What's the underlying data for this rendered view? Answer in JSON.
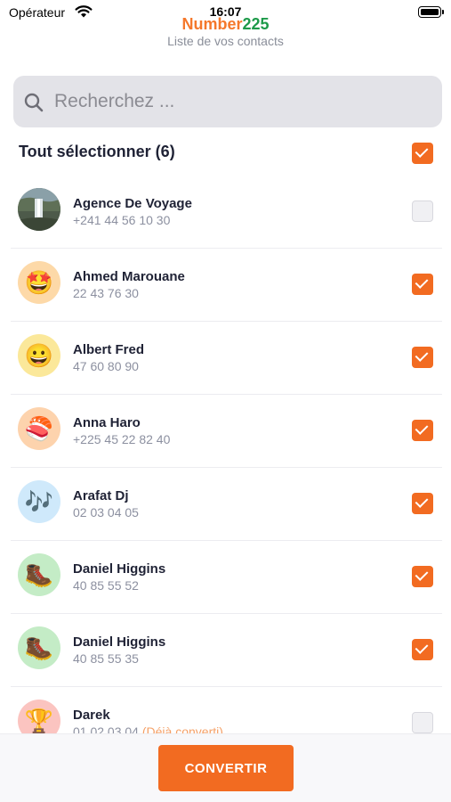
{
  "status_bar": {
    "carrier": "Opérateur",
    "time": "16:07"
  },
  "header": {
    "brand_part1": "Number",
    "brand_part2": "225",
    "subtitle": "Liste de vos contacts"
  },
  "search": {
    "placeholder": "Recherchez ..."
  },
  "select_all": {
    "label": "Tout sélectionner (6)",
    "checked": true
  },
  "contacts": [
    {
      "name": "Agence De Voyage",
      "phone": "+241 44 56 10 30",
      "avatar": "photo-waterfall",
      "checked": false
    },
    {
      "name": "Ahmed Marouane",
      "phone": "22 43 76 30",
      "avatar": "🤩",
      "checked": true
    },
    {
      "name": "Albert Fred",
      "phone": "47 60 80 90",
      "avatar": "😀",
      "checked": true
    },
    {
      "name": "Anna Haro",
      "phone": "+225 45 22 82 40",
      "avatar": "🍣",
      "checked": true
    },
    {
      "name": "Arafat Dj",
      "phone": "02 03 04 05",
      "avatar": "🎶",
      "checked": true
    },
    {
      "name": "Daniel Higgins",
      "phone": "40 85 55 52",
      "avatar": "🥾",
      "checked": true
    },
    {
      "name": "Daniel Higgins",
      "phone": "40 85 55 35",
      "avatar": "🥾",
      "checked": true
    },
    {
      "name": "Darek",
      "phone": "01 02 03 04",
      "note": "(Déjà converti)",
      "avatar": "🏆",
      "checked": false
    }
  ],
  "colors": {
    "accent": "#f26b21",
    "brand_green": "#1d9a49",
    "brand_orange": "#f5782b"
  },
  "bottom": {
    "convert_label": "CONVERTIR"
  }
}
